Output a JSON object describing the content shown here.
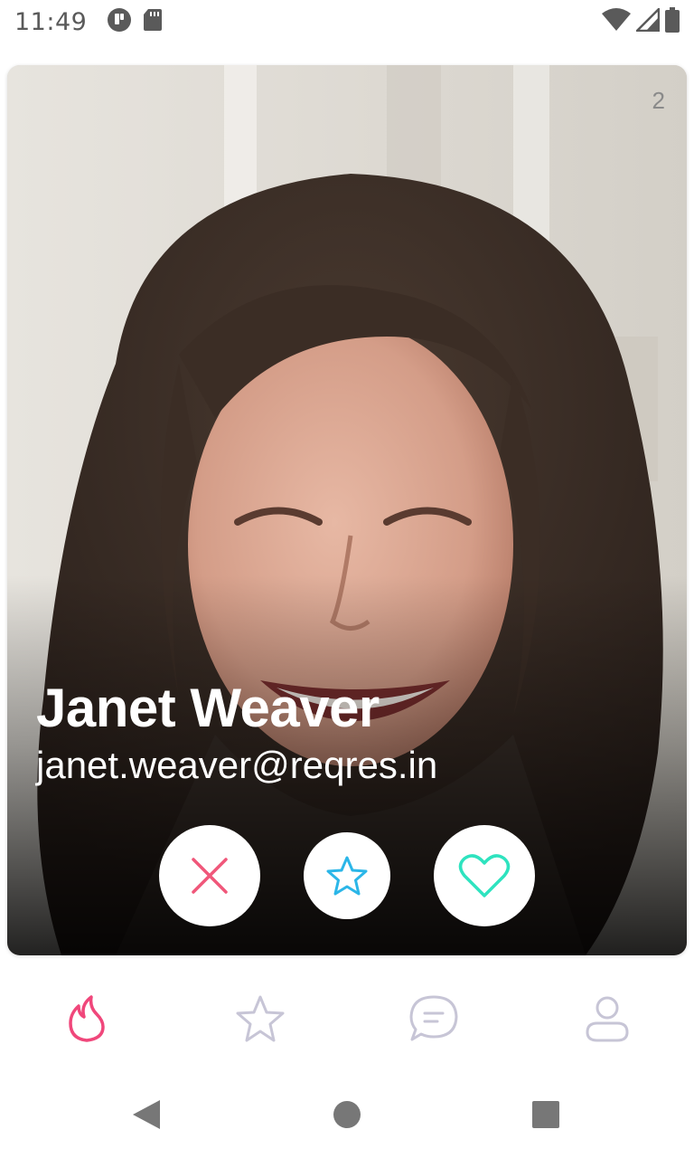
{
  "status_bar": {
    "time": "11:49",
    "icons": [
      "app-notification-icon",
      "sd-card-icon",
      "wifi-icon",
      "signal-icon",
      "battery-icon"
    ]
  },
  "card": {
    "counter": "2",
    "name": "Janet Weaver",
    "email": "janet.weaver@reqres.in",
    "actions": [
      {
        "name": "dislike",
        "icon": "close-icon",
        "color": "#f0577a"
      },
      {
        "name": "super-like",
        "icon": "star-icon",
        "color": "#2bb6e8"
      },
      {
        "name": "like",
        "icon": "heart-icon",
        "color": "#2ee3bf"
      }
    ]
  },
  "tabs": [
    {
      "name": "discover",
      "icon": "flame-icon",
      "active": true,
      "color": "#f0477b"
    },
    {
      "name": "favorites",
      "icon": "star-icon",
      "active": false,
      "color": "#c7c5d6"
    },
    {
      "name": "messages",
      "icon": "chat-icon",
      "active": false,
      "color": "#c7c5d6"
    },
    {
      "name": "profile",
      "icon": "user-icon",
      "active": false,
      "color": "#c7c5d6"
    }
  ],
  "nav_bar": {
    "buttons": [
      "back-icon",
      "home-icon",
      "recents-icon"
    ]
  }
}
